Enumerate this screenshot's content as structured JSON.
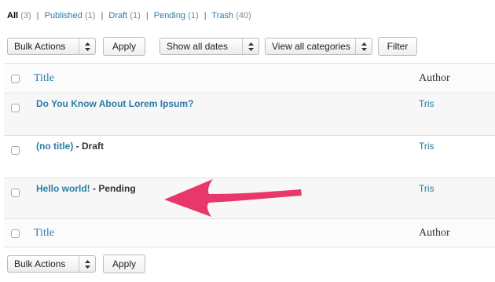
{
  "status_links": [
    {
      "label": "All",
      "count": "(3)"
    },
    {
      "label": "Published",
      "count": "(1)"
    },
    {
      "label": "Draft",
      "count": "(1)"
    },
    {
      "label": "Pending",
      "count": "(1)"
    },
    {
      "label": "Trash",
      "count": "(40)"
    }
  ],
  "status_separator": "|",
  "top_nav": {
    "bulk_actions": "Bulk Actions",
    "apply": "Apply",
    "date_filter": "Show all dates",
    "category_filter": "View all categories",
    "filter": "Filter"
  },
  "bottom_nav": {
    "bulk_actions": "Bulk Actions",
    "apply": "Apply"
  },
  "table": {
    "header_title": "Title",
    "header_author": "Author",
    "footer_title": "Title",
    "footer_author": "Author",
    "rows": [
      {
        "title": "Do You Know About Lorem Ipsum?",
        "state": "",
        "author": "Tris"
      },
      {
        "title": "(no title)",
        "state": "- Draft",
        "author": "Tris"
      },
      {
        "title": "Hello world!",
        "state": "- Pending",
        "author": "Tris"
      }
    ]
  },
  "annotation": {
    "color": "#e8386b"
  },
  "colors": {
    "link": "#2a7ca8"
  }
}
